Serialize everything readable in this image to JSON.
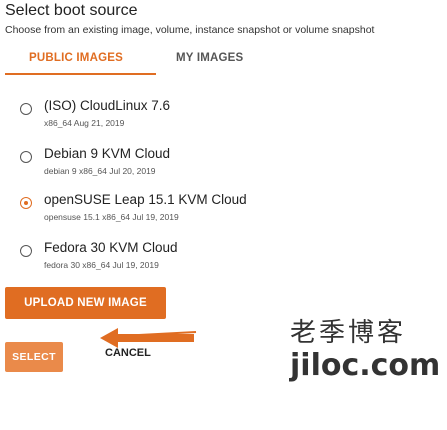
{
  "header": {
    "title": "Select boot source",
    "subtitle": "Choose from an existing image, volume, instance snapshot or volume snapshot"
  },
  "tabs": [
    {
      "label": "PUBLIC IMAGES",
      "active": true
    },
    {
      "label": "MY IMAGES",
      "active": false
    }
  ],
  "images": [
    {
      "name": "(ISO) CloudLinux 7.6",
      "desc": "x86_64 Aug 21, 2019",
      "selected": false
    },
    {
      "name": "Debian 9 KVM Cloud",
      "desc": "debian 9 x86_64 Jul 20, 2019",
      "selected": false
    },
    {
      "name": "openSUSE Leap 15.1 KVM Cloud",
      "desc": "opensuse 15.1 x86_64 Jul 19, 2019",
      "selected": true
    },
    {
      "name": "Fedora 30 KVM Cloud",
      "desc": "fedora 30 x86_64 Jul 19, 2019",
      "selected": false
    }
  ],
  "actions": {
    "upload_label": "UPLOAD NEW IMAGE",
    "select_label": "SELECT",
    "cancel_label": "CANCEL"
  },
  "watermark": {
    "line1": "老季博客",
    "line2": "jiloc.com"
  },
  "colors": {
    "accent": "#e06d22",
    "accent_light": "#ea8a4a"
  },
  "icons": {
    "radio_unchecked": "radio-unchecked-icon",
    "radio_checked": "radio-checked-icon",
    "arrow": "left-arrow-icon"
  }
}
